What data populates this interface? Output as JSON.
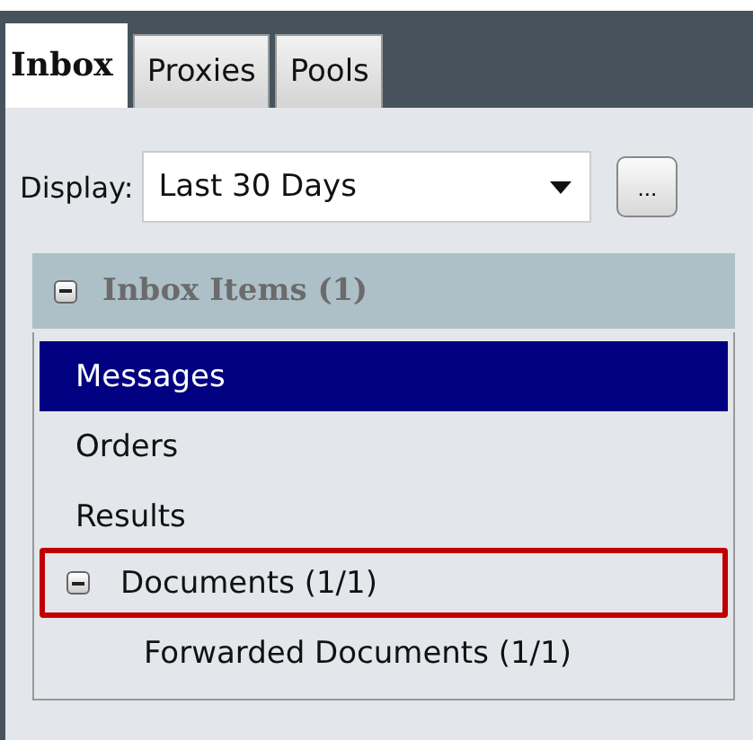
{
  "tabs": [
    {
      "label": "Inbox",
      "selected": true
    },
    {
      "label": "Proxies",
      "selected": false
    },
    {
      "label": "Pools",
      "selected": false
    }
  ],
  "display": {
    "label": "Display:",
    "value": "Last 30 Days",
    "button": "..."
  },
  "section": {
    "title": "Inbox Items (1)",
    "expanded": true
  },
  "items": [
    {
      "label": "Messages",
      "selected": true,
      "highlighted": false
    },
    {
      "label": "Orders",
      "selected": false,
      "highlighted": false
    },
    {
      "label": "Results",
      "selected": false,
      "highlighted": false
    },
    {
      "label": "Documents (1/1)",
      "selected": false,
      "highlighted": true,
      "expanded": true,
      "children": [
        {
          "label": "Forwarded Documents (1/1)",
          "selected": false,
          "highlighted": false
        }
      ]
    }
  ]
}
